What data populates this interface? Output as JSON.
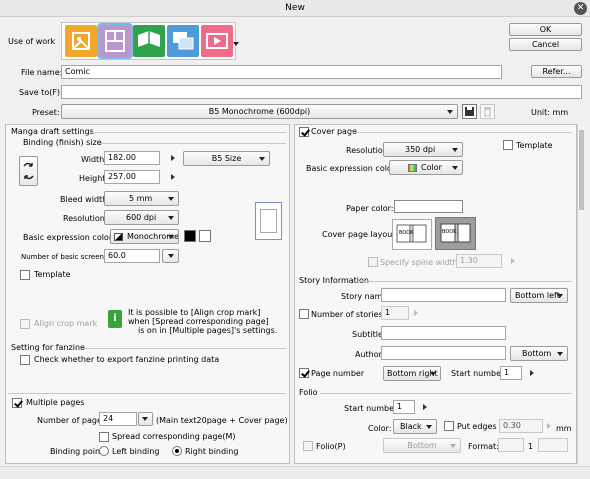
{
  "window": {
    "title": "New"
  },
  "top": {
    "use_of_work_label": "Use of work",
    "ok_label": "OK",
    "cancel_label": "Cancel",
    "file_name_label": "File name:",
    "file_name_value": "Comic",
    "refer_label": "Refer...",
    "save_to_label": "Save to(F):",
    "save_to_value": "",
    "preset_label": "Preset:",
    "preset_value": "B5 Monochrome (600dpi)",
    "unit_label": "Unit: mm"
  },
  "manga": {
    "section_title": "Manga draft settings",
    "binding_title": "Binding (finish) size",
    "width_label": "Width:",
    "width_value": "182.00",
    "height_label": "Height:",
    "height_value": "257.00",
    "size_preset": "B5 Size",
    "bleed_label": "Bleed width:",
    "bleed_value": "5 mm",
    "resolution_label": "Resolution:",
    "resolution_value": "600 dpi",
    "basic_color_label": "Basic expression color:",
    "basic_color_value": "Monochrome",
    "screen_freq_label": "Number of basic screen frequen",
    "screen_freq_value": "60.0",
    "template_label": "Template",
    "align_crop_label": "Align crop mark",
    "info_text_1": "It is possible to [Align crop mark]",
    "info_text_2": "when [Spread corresponding page]",
    "info_text_3": "is on in [Multiple pages]'s settings."
  },
  "fanzine": {
    "title": "Setting for fanzine",
    "check_label": "Check whether to export fanzine printing data"
  },
  "multiple": {
    "label": "Multiple pages",
    "num_pages_label": "Number of pages:",
    "num_pages_value": "24",
    "num_pages_note": "(Main text20page + Cover page)",
    "spread_label": "Spread corresponding page(M)",
    "binding_point_label": "Binding point:",
    "left_binding": "Left binding",
    "right_binding": "Right binding"
  },
  "cover": {
    "label": "Cover page",
    "resolution_label": "Resolution:",
    "resolution_value": "350 dpi",
    "template_label": "Template",
    "basic_color_label": "Basic expression color:",
    "basic_color_value": "Color",
    "paper_color_label": "Paper color:",
    "layout_label": "Cover page layout:",
    "spine_label": "Specify spine width",
    "spine_value": "1.30"
  },
  "story": {
    "title": "Story Information",
    "story_name_label": "Story name:",
    "story_name_pos": "Bottom left",
    "num_stories_label": "Number of stories",
    "num_stories_value": "1",
    "subtitle_label": "Subtitle:",
    "author_label": "Author:",
    "author_pos": "Bottom",
    "page_number_label": "Page number",
    "page_number_pos": "Bottom right",
    "start_number_label": "Start number:",
    "start_number_value": "1"
  },
  "folio": {
    "title": "Folio",
    "start_number_label": "Start number:",
    "start_number_value": "1",
    "color_label": "Color:",
    "color_value": "Black",
    "put_edges_label": "Put edges",
    "put_edges_value": "0.30",
    "unit": "mm",
    "folio_label": "Folio(P)",
    "folio_pos": "Bottom",
    "format_label": "Format:",
    "format_sep": "1"
  },
  "colors": {
    "accent": "#7bbde8",
    "info_green": "#3aa23a"
  },
  "icons": [
    "illustration-icon",
    "comic-icon",
    "webtoon-icon",
    "animation-icon",
    "timelapse-icon"
  ]
}
